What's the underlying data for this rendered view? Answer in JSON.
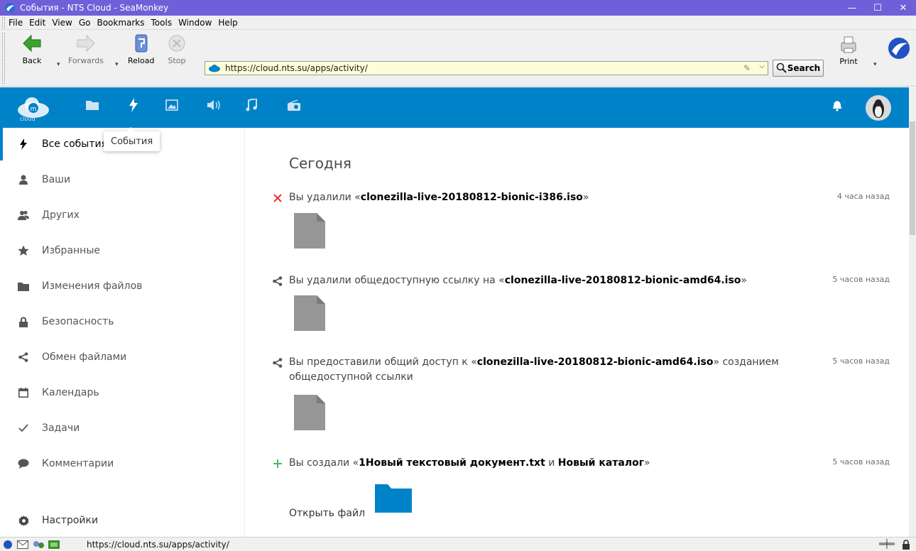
{
  "window": {
    "title": "События - NTS Cloud - SeaMonkey",
    "minimize_glyph": "—",
    "maximize_glyph": "☐",
    "close_glyph": "✕"
  },
  "menu": [
    "File",
    "Edit",
    "View",
    "Go",
    "Bookmarks",
    "Tools",
    "Window",
    "Help"
  ],
  "toolbar": {
    "back_label": "Back",
    "forward_label": "Forwards",
    "reload_label": "Reload",
    "stop_label": "Stop",
    "url": "https://cloud.nts.su/apps/activity/",
    "search_label": "Search",
    "print_label": "Print"
  },
  "app": {
    "logo_subtext": "cloud",
    "tooltip": "События",
    "header_icons": [
      "files-icon",
      "activity-icon",
      "gallery-icon",
      "audio-player-icon",
      "music-icon",
      "radio-icon"
    ]
  },
  "sidebar": {
    "items": [
      {
        "label": "Все события",
        "icon": "lightning-icon"
      },
      {
        "label": "Ваши",
        "icon": "user-icon"
      },
      {
        "label": "Других",
        "icon": "users-icon"
      },
      {
        "label": "Избранные",
        "icon": "star-icon"
      },
      {
        "label": "Изменения файлов",
        "icon": "folder-icon"
      },
      {
        "label": "Безопасность",
        "icon": "lock-icon"
      },
      {
        "label": "Обмен файлами",
        "icon": "share-icon"
      },
      {
        "label": "Календарь",
        "icon": "calendar-icon"
      },
      {
        "label": "Задачи",
        "icon": "checkmark-icon"
      },
      {
        "label": "Комментарии",
        "icon": "comment-icon"
      }
    ],
    "settings_label": "Настройки"
  },
  "main": {
    "heading": "Сегодня",
    "activities": [
      {
        "icon": "delete-icon",
        "prefix": "Вы удалили «",
        "bold1": "clonezilla-live-20180812-bionic-i386.iso",
        "suffix": "»",
        "time": "4 часа назад"
      },
      {
        "icon": "share-icon",
        "prefix": "Вы удалили общедоступную ссылку на «",
        "bold1": "clonezilla-live-20180812-bionic-amd64.iso",
        "suffix": "»",
        "time": "5 часов назад"
      },
      {
        "icon": "share-icon",
        "prefix": "Вы предоставили общий доступ к «",
        "bold1": "clonezilla-live-20180812-bionic-amd64.iso",
        "suffix": "» созданием общедоступной ссылки",
        "time": "5 часов назад"
      },
      {
        "icon": "add-icon",
        "prefix": "Вы создали «",
        "bold1": "1Новый текстовый документ.txt",
        "middle": " и ",
        "bold2": "Новый каталог",
        "suffix": "»",
        "time": "5 часов назад",
        "open_file_label": "Открыть файл"
      }
    ]
  },
  "status": {
    "url": "https://cloud.nts.su/apps/activity/"
  },
  "colors": {
    "titlebar": "#6f5fd8",
    "app_header": "#0082c9",
    "delete_red": "#e9322d",
    "add_green": "#46ba61",
    "folder_blue": "#0082c9"
  }
}
